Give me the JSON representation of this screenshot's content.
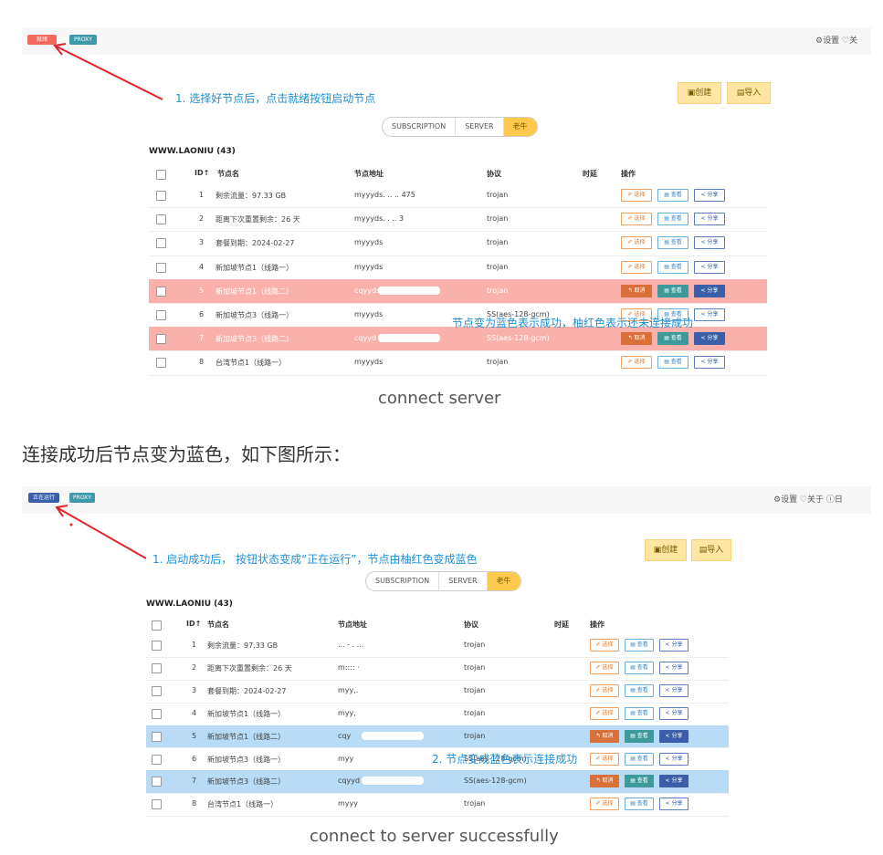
{
  "top_section": {
    "status_button": "就绪",
    "proxy_chip": "PROXY",
    "top_icons": "⚙设置  ♡关",
    "annotation": "1. 选择好节点后，点击就绪按钮启动节点",
    "create_btn": "▣创建",
    "import_btn": "▤导入",
    "tabs": [
      "SUBSCRIPTION",
      "SERVER",
      "老牛"
    ],
    "group_title": "WWW.LAONIU            (43)",
    "headers": {
      "id": "ID↑",
      "name": "节点名",
      "addr": "节点地址",
      "proto": "协议",
      "latency": "时延",
      "ops": "操作"
    },
    "rows": [
      {
        "id": "1",
        "name": "剩余流量：97.33 GB",
        "addr": "myyyds.            .. .. 475",
        "proto": "trojan",
        "state": "normal"
      },
      {
        "id": "2",
        "name": "距离下次重置剩余：26 天",
        "addr": "myyyds.                . .. 3",
        "proto": "trojan",
        "state": "normal"
      },
      {
        "id": "3",
        "name": "套餐到期：2024-02-27",
        "addr": "myyyds",
        "proto": "trojan",
        "state": "normal"
      },
      {
        "id": "4",
        "name": "新加坡节点1（线路一）",
        "addr": "myyyds",
        "proto": "trojan",
        "state": "normal"
      },
      {
        "id": "5",
        "name": "新加坡节点1（线路二）",
        "addr": "cqyyds.",
        "proto": "trojan",
        "state": "red"
      },
      {
        "id": "6",
        "name": "新加坡节点3（线路一）",
        "addr": "myyyds",
        "proto": "SS(aes-128-gcm)",
        "state": "normal"
      },
      {
        "id": "7",
        "name": "新加坡节点3（线路二）",
        "addr": "cqyyd",
        "proto": "SS(aes-128-gcm)",
        "state": "red"
      },
      {
        "id": "8",
        "name": "台湾节点1（线路一）",
        "addr": "myyyds",
        "proto": "trojan",
        "state": "normal"
      }
    ],
    "actions": {
      "select": "✐ 选择",
      "view": "▤ 查看",
      "share": "< 分享",
      "cancel": "↰ 取消"
    },
    "overlay_note": "节点变为蓝色表示成功，柚红色表示还未连接成功",
    "caption": "connect server"
  },
  "middle_heading": "连接成功后节点变为蓝色，如下图所示：",
  "bottom_section": {
    "status_button": "正在运行",
    "proxy_chip": "PROXY",
    "top_icons": "⚙设置   ♡关于   ⓘ日",
    "annotation": "1. 启动成功后， 按钮状态变成“正在运行”，节点由柚红色变成蓝色",
    "create_btn": "▣创建",
    "import_btn": "▤导入",
    "tabs": [
      "SUBSCRIPTION",
      "SERVER",
      "老牛"
    ],
    "group_title": "WWW.LAONIU           (43)",
    "headers": {
      "id": "ID↑",
      "name": "节点名",
      "addr": "节点地址",
      "proto": "协议",
      "latency": "时延",
      "ops": "操作"
    },
    "rows": [
      {
        "id": "1",
        "name": "剩余流量：97.33 GB",
        "addr": "...  -  .  ...",
        "proto": "trojan",
        "state": "normal"
      },
      {
        "id": "2",
        "name": "距离下次重置剩余：26 天",
        "addr": "m:::: ·",
        "proto": "trojan",
        "state": "normal"
      },
      {
        "id": "3",
        "name": "套餐到期：2024-02-27",
        "addr": "myy,.",
        "proto": "trojan",
        "state": "normal"
      },
      {
        "id": "4",
        "name": "新加坡节点1（线路一）",
        "addr": "myy,",
        "proto": "trojan",
        "state": "normal"
      },
      {
        "id": "5",
        "name": "新加坡节点1（线路二）",
        "addr": "cqy",
        "proto": "trojan",
        "state": "blue"
      },
      {
        "id": "6",
        "name": "新加坡节点3（线路一）",
        "addr": "myy",
        "proto": "SS(aes-128-gcm)",
        "state": "normal"
      },
      {
        "id": "7",
        "name": "新加坡节点3（线路二）",
        "addr": "cqyyd",
        "proto": "SS(aes-128-gcm)",
        "state": "blue"
      },
      {
        "id": "8",
        "name": "台湾节点1（线路一）",
        "addr": "myyy",
        "proto": "trojan",
        "state": "normal"
      }
    ],
    "actions": {
      "select": "✐ 选择",
      "view": "▤ 查看",
      "share": "< 分享",
      "cancel": "↰ 取消"
    },
    "overlay_note": "2. 节点变成蓝色表示连接成功",
    "caption": "connect to server successfully"
  },
  "colors": {
    "annotation": "#1e90d6",
    "arrow": "#e0242a",
    "red_row": "#fab1ab",
    "blue_row": "#b8dcf5",
    "tab_active": "#ffc94d"
  }
}
